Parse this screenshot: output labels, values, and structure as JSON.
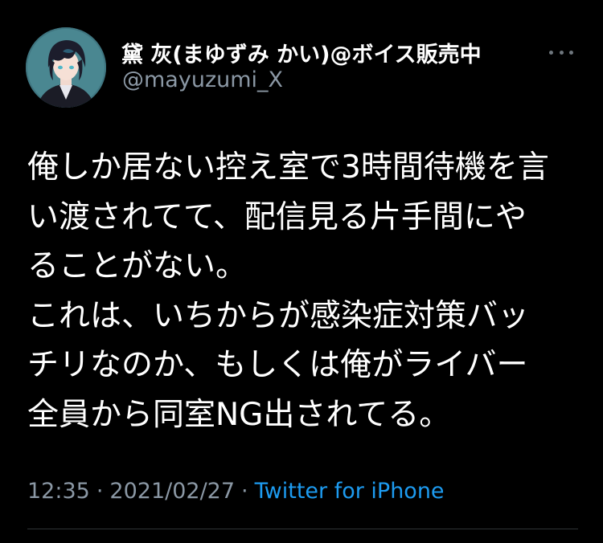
{
  "theme": {
    "background": "#000000",
    "text_primary": "#ffffff",
    "text_secondary": "#8b98a5",
    "link": "#1d9bf0"
  },
  "author": {
    "display_name": "黛 灰(まゆずみ かい)@ボイス販売中",
    "handle": "@mayuzumi_X",
    "avatar_icon": "avatar-image"
  },
  "more_icon": "more-horizontal-icon",
  "tweet": {
    "lines": [
      "俺しか居ない控え室で3時間待機を言",
      "い渡されてて、配信見る片手間にや",
      "ることがない。",
      "これは、いちからが感染症対策バッ",
      "チリなのか、もしくは俺がライバー",
      "全員から同室NG出されてる。"
    ]
  },
  "meta": {
    "time": "12:35",
    "separator": "·",
    "date": "2021/02/27",
    "source": "Twitter for iPhone"
  }
}
